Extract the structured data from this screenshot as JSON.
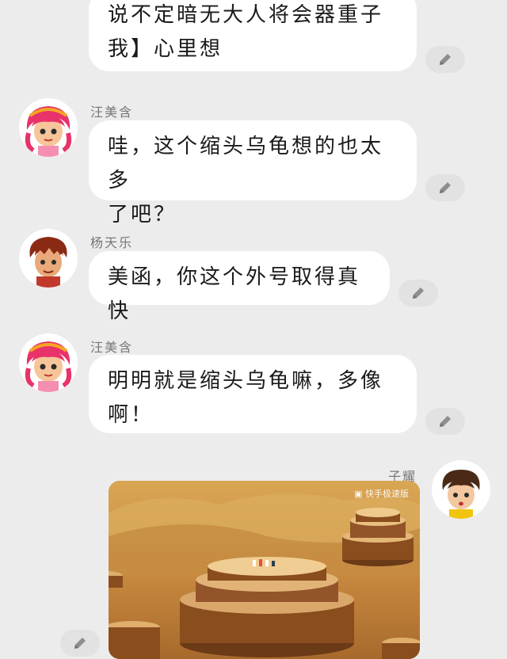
{
  "messages": [
    {
      "sender": "",
      "lines": [
        "说不定暗无大人将会器重子",
        "我】心里想"
      ]
    },
    {
      "sender": "汪美含",
      "lines": [
        "哇，这个缩头乌龟想的也太多",
        "了吧？"
      ]
    },
    {
      "sender": "杨天乐",
      "lines": [
        "美函，你这个外号取得真快"
      ]
    },
    {
      "sender": "汪美含",
      "lines": [
        "明明就是缩头乌龟嘛，多像",
        "啊！"
      ]
    },
    {
      "sender": "子耀",
      "video_watermark": "快手极速版"
    }
  ],
  "icons": {
    "edit": "pencil-icon",
    "brand": "kuaishou-logo-icon"
  },
  "colors": {
    "background": "#ececec",
    "bubble": "#ffffff",
    "edit_button": "#e2e2e2",
    "pencil": "#8e8e8e"
  }
}
